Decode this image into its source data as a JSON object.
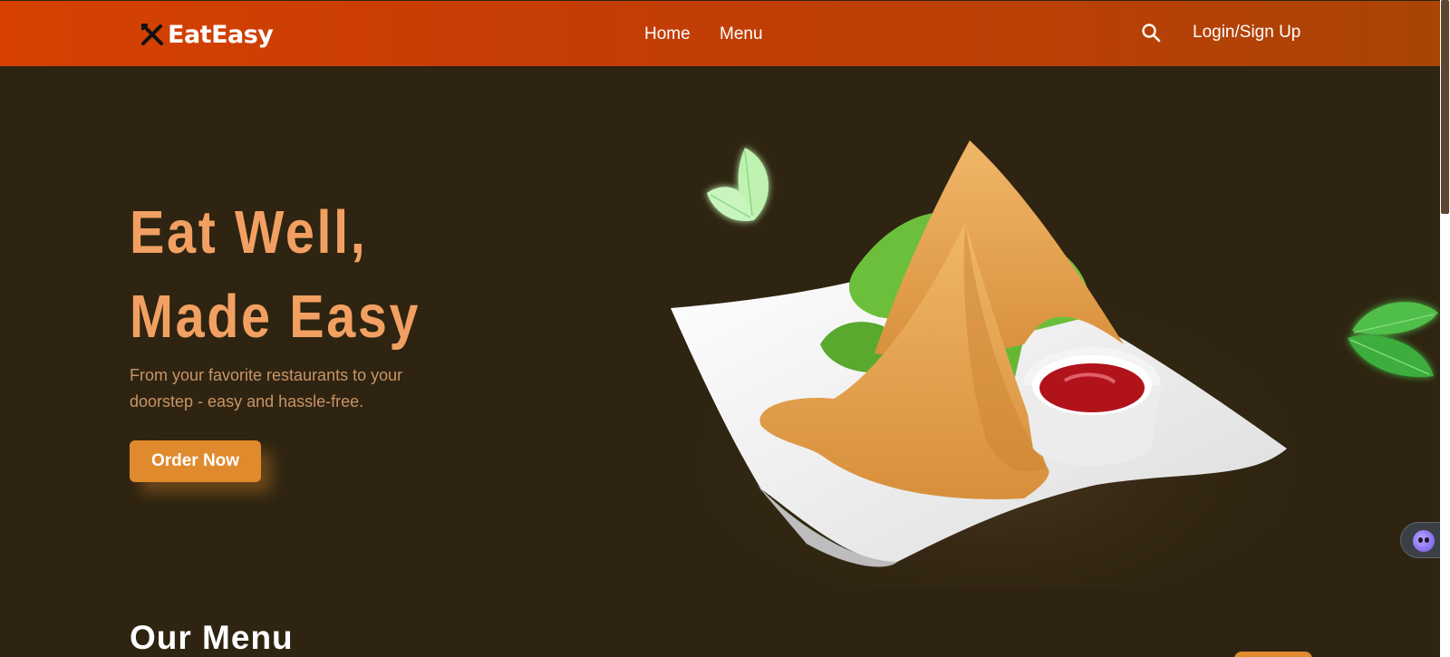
{
  "brand": {
    "name": "EatEasy",
    "icon": "fork-knife-icon"
  },
  "nav": {
    "home_label": "Home",
    "menu_label": "Menu",
    "search_icon": "search-icon",
    "login_label": "Login/Sign Up"
  },
  "hero": {
    "title_line1": "Eat Well,",
    "title_line2": "Made Easy",
    "subtitle": "From your favorite restaurants to your doorstep - easy and hassle-free.",
    "cta_label": "Order Now"
  },
  "sections": {
    "menu_title": "Our Menu"
  },
  "widget": {
    "icon": "assistant-face-icon"
  },
  "colors": {
    "nav_start": "#d64100",
    "nav_end": "#a94405",
    "background": "#2e2411",
    "title": "#f2a062",
    "subtitle": "#c99466",
    "button": "#e08a2e"
  }
}
